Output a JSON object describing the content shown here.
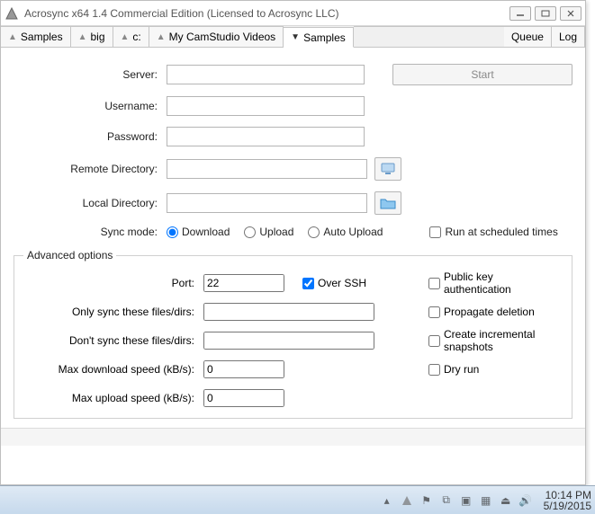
{
  "window": {
    "title": "Acrosync x64 1.4 Commercial Edition (Licensed to Acrosync LLC)"
  },
  "tabs": {
    "items": [
      "Samples",
      "big",
      "c:",
      "My CamStudio Videos",
      "Samples"
    ],
    "activeIndex": 4,
    "queue": "Queue",
    "log": "Log"
  },
  "form": {
    "server_label": "Server:",
    "server_value": "",
    "start_label": "Start",
    "username_label": "Username:",
    "username_value": "",
    "password_label": "Password:",
    "password_value": "",
    "remote_dir_label": "Remote Directory:",
    "remote_dir_value": "",
    "local_dir_label": "Local Directory:",
    "local_dir_value": "",
    "sync_mode_label": "Sync mode:",
    "sync_download": "Download",
    "sync_upload": "Upload",
    "sync_auto": "Auto Upload",
    "scheduled_label": "Run at scheduled times"
  },
  "advanced": {
    "legend": "Advanced options",
    "port_label": "Port:",
    "port_value": "22",
    "over_ssh": "Over SSH",
    "pubkey": "Public key authentication",
    "only_sync_label": "Only sync these files/dirs:",
    "only_sync_value": "",
    "propagate": "Propagate deletion",
    "dont_sync_label": "Don't sync these files/dirs:",
    "dont_sync_value": "",
    "incremental": "Create incremental snapshots",
    "max_down_label": "Max download speed (kB/s):",
    "max_down_value": "0",
    "dry_run": "Dry run",
    "max_up_label": "Max upload speed (kB/s):",
    "max_up_value": "0"
  },
  "taskbar": {
    "time": "10:14 PM",
    "date": "5/19/2015"
  }
}
